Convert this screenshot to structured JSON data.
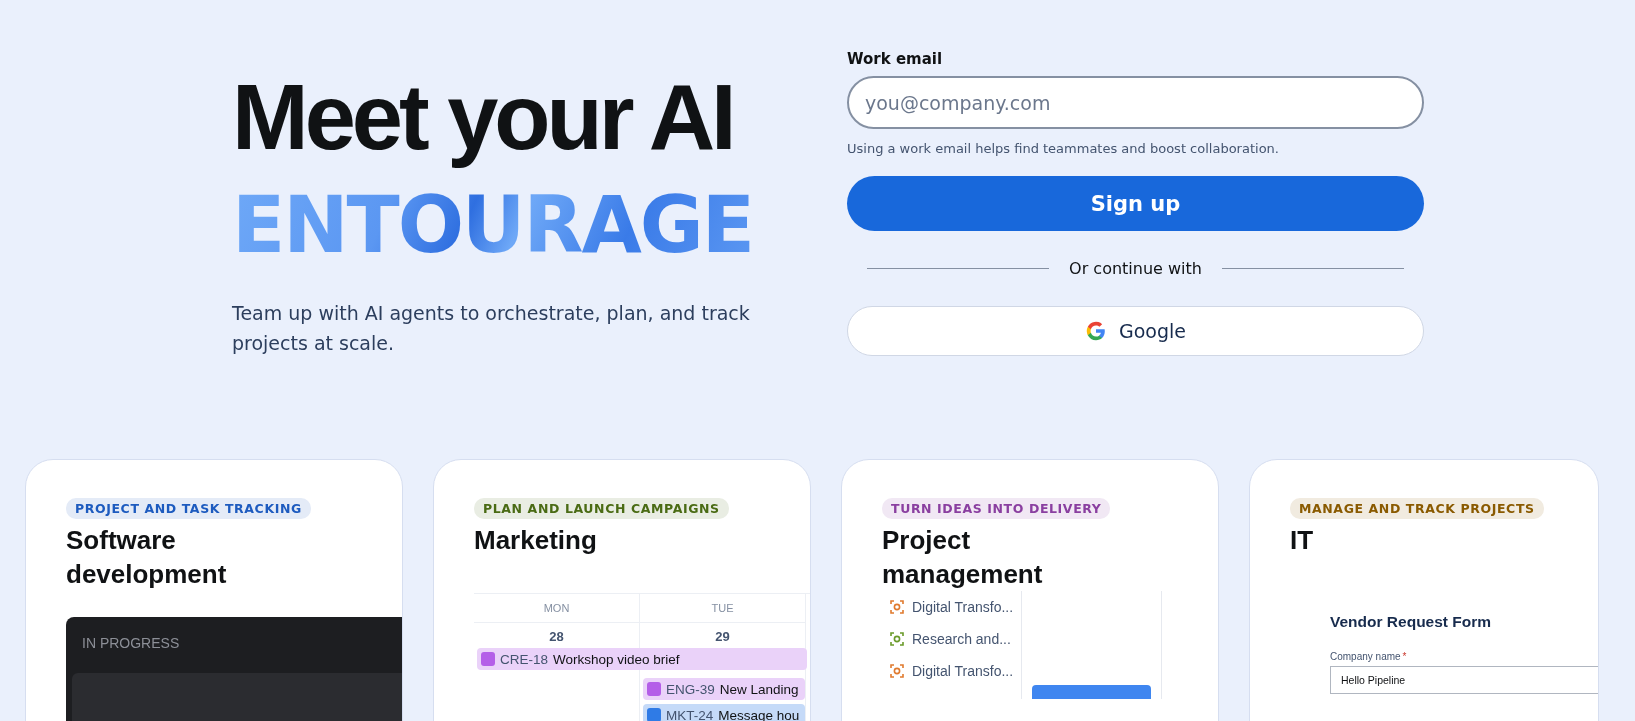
{
  "hero": {
    "headline": "Meet your AI",
    "highlight": "ENTOURAGE",
    "subtitle": "Team up with AI agents to orchestrate, plan, and track projects at scale."
  },
  "signup": {
    "label": "Work email",
    "placeholder": "you@company.com",
    "hint": "Using a work email helps find teammates and boost collaboration.",
    "button": "Sign up",
    "divider": "Or continue with",
    "providers": [
      {
        "label": "Google"
      }
    ]
  },
  "cards": [
    {
      "kind": "board",
      "tag": "PROJECT AND TASK TRACKING",
      "color": "#1d5bbf",
      "title": "Software development",
      "column": "IN PROGRESS"
    },
    {
      "kind": "calendar",
      "tag": "PLAN AND LAUNCH CAMPAIGNS",
      "color": "#4a6b14",
      "title": "Marketing",
      "days": [
        {
          "day": "MON",
          "date": "28",
          "events": [
            {
              "key": "CRE-18",
              "title": "Workshop video brief",
              "color": "#b45ee8",
              "wide": true
            }
          ]
        },
        {
          "day": "TUE",
          "date": "29",
          "events": [
            {
              "key": "ENG-39",
              "title": "New Landing",
              "color": "#b45ee8",
              "wide": false
            },
            {
              "key": "MKT-24",
              "title": "Message hou",
              "color": "#2f7be6",
              "wide": false
            }
          ]
        }
      ]
    },
    {
      "kind": "timeline",
      "tag": "TURN IDEAS INTO DELIVERY",
      "color": "#8a3fa0",
      "title": "Project management",
      "items": [
        {
          "label": "Digital Transfo...",
          "color": "#e07a2e"
        },
        {
          "label": "Research and...",
          "color": "#6a9a2a"
        },
        {
          "label": "Digital Transfo...",
          "color": "#e07a2e"
        }
      ]
    },
    {
      "kind": "form",
      "tag": "MANAGE AND TRACK PROJECTS",
      "color": "#8a5a00",
      "title": "IT",
      "form_title": "Vendor Request Form",
      "field_label": "Company name",
      "required": "*",
      "field_value": "Hello Pipeline"
    }
  ]
}
